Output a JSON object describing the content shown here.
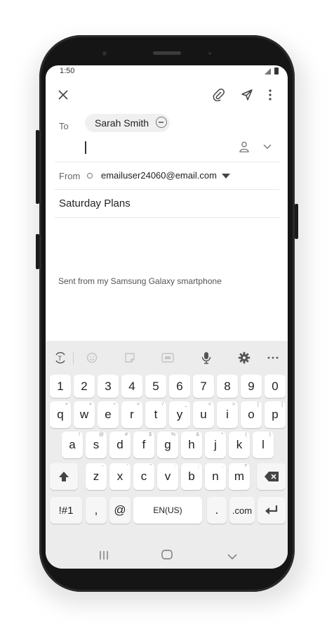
{
  "status": {
    "time": "1:50"
  },
  "toolbar": {
    "icons": [
      "close-icon",
      "attachment-icon",
      "send-icon",
      "more-vertical-icon"
    ]
  },
  "compose": {
    "to_label": "To",
    "recipient": "Sarah Smith",
    "from_label": "From",
    "from_value": "emailuser24060@email.com",
    "subject": "Saturday Plans",
    "signature": "Sent from my Samsung Galaxy smartphone"
  },
  "keyboard": {
    "numbers": [
      "1",
      "2",
      "3",
      "4",
      "5",
      "6",
      "7",
      "8",
      "9",
      "0"
    ],
    "row1": [
      "q",
      "w",
      "e",
      "r",
      "t",
      "y",
      "u",
      "i",
      "o",
      "p"
    ],
    "row1_hints": [
      "+",
      "×",
      "÷",
      "=",
      "/",
      "_",
      "<",
      ">",
      "[",
      "]"
    ],
    "row2": [
      "a",
      "s",
      "d",
      "f",
      "g",
      "h",
      "j",
      "k",
      "l"
    ],
    "row2_hints": [
      "!",
      "@",
      "#",
      "$",
      "%",
      "&",
      "*",
      "(",
      ")"
    ],
    "row3": [
      "z",
      "x",
      "c",
      "v",
      "b",
      "n",
      "m"
    ],
    "row3_hints": [
      "-",
      "'",
      "\"",
      ":",
      ";",
      ",",
      "?"
    ],
    "sym_label": "!#1",
    "comma": ",",
    "at": "@",
    "space_label": "EN(US)",
    "period": ".",
    "com_label": ".com",
    "toolbar_icons": [
      "text-recognition-icon",
      "emoji-icon",
      "sticker-icon",
      "gif-icon",
      "microphone-icon",
      "settings-icon",
      "more-horizontal-icon"
    ]
  },
  "colors": {
    "keyboard_bg": "#ececec",
    "key_bg": "#ffffff",
    "text": "#222222"
  }
}
